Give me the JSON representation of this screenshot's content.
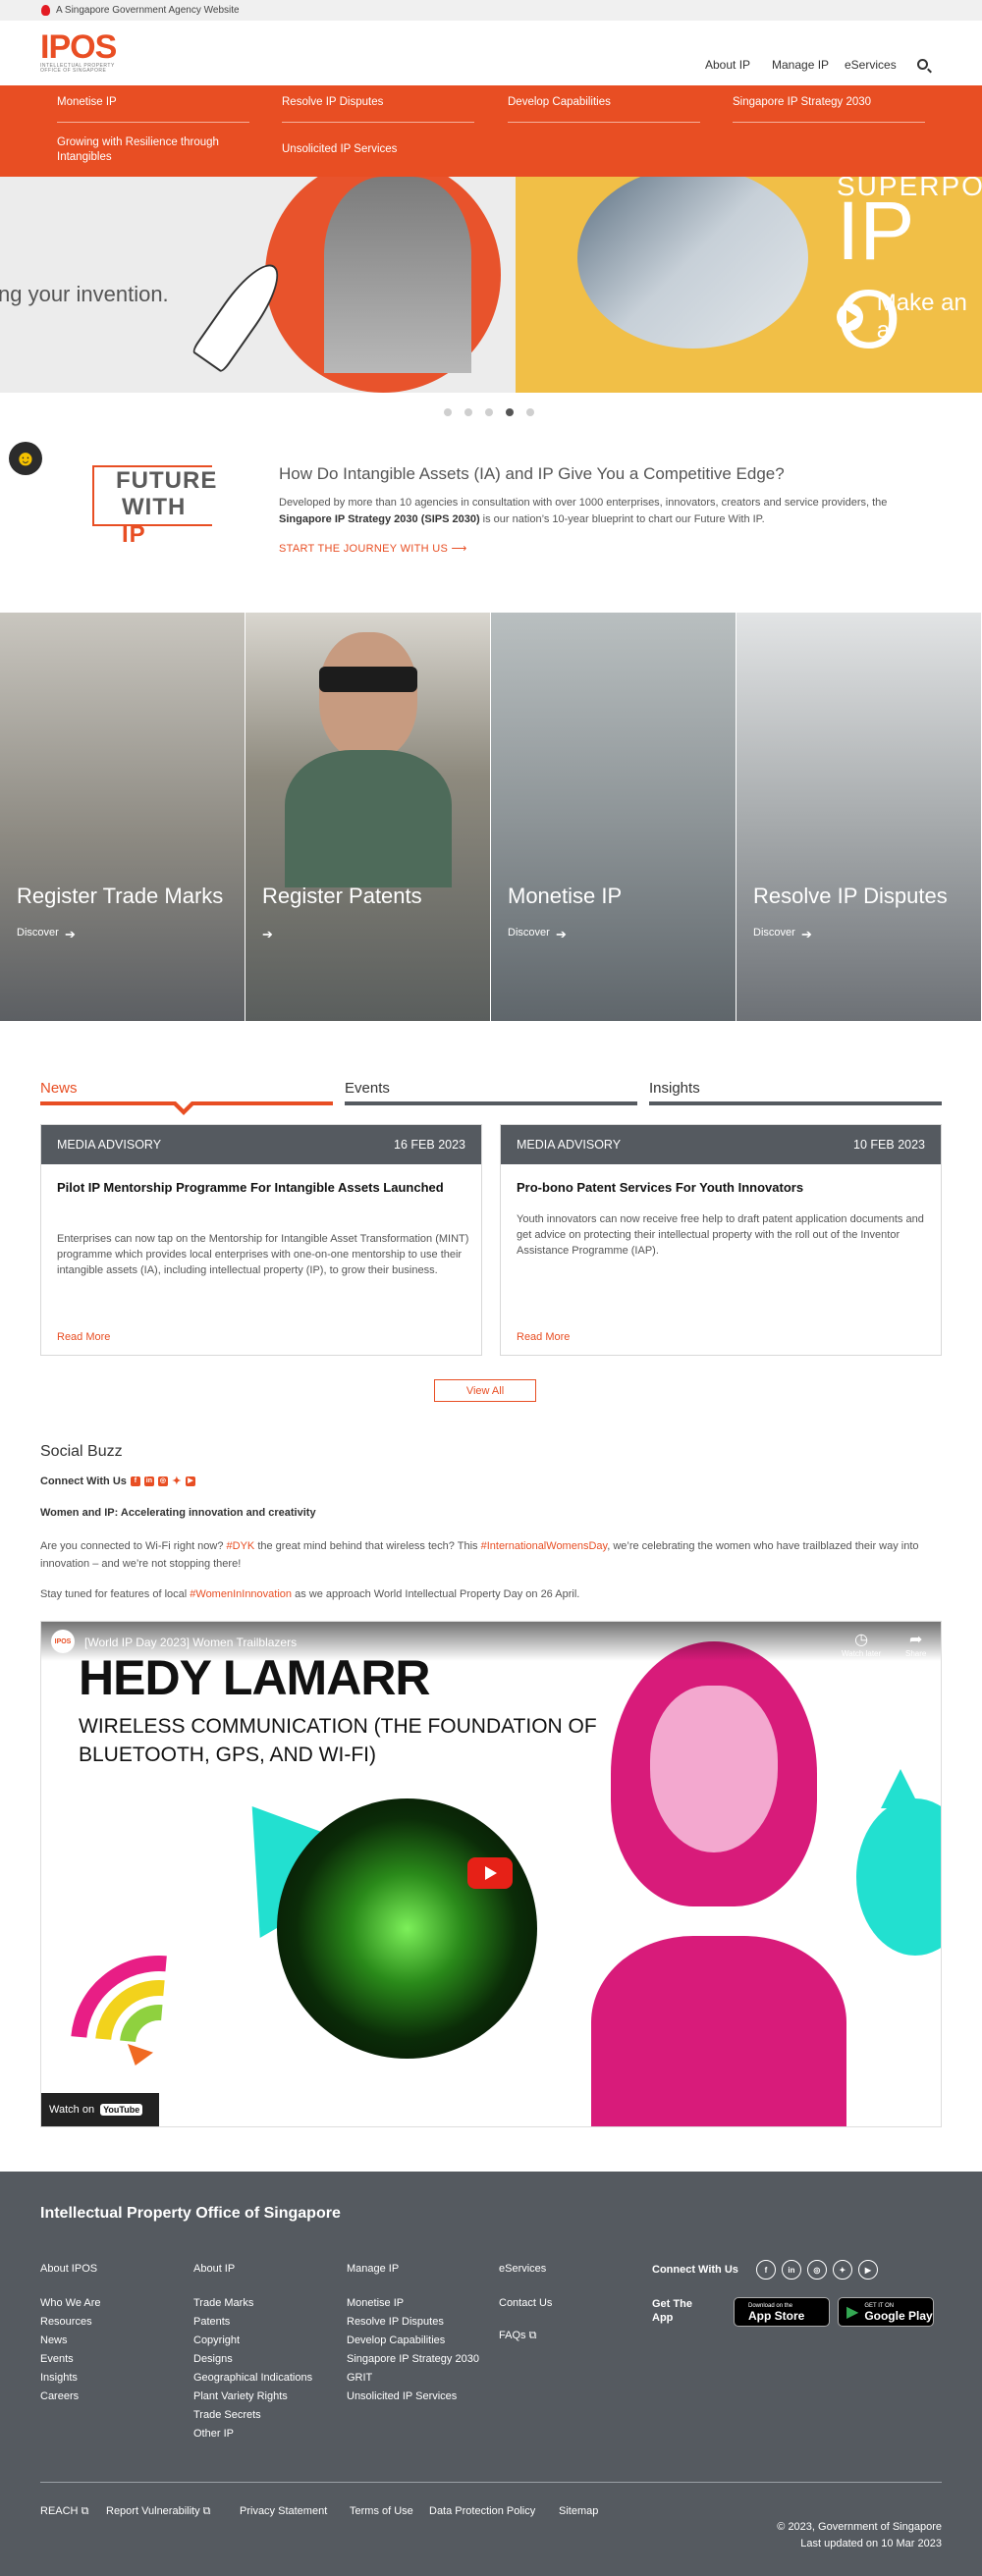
{
  "topbar": {
    "text": "A Singapore Government Agency Website"
  },
  "logo": {
    "name": "IPOS",
    "sub": "INTELLECTUAL PROPERTY OFFICE OF SINGAPORE"
  },
  "nav": [
    "About IP",
    "Manage IP",
    "eServices"
  ],
  "orange_menu": [
    "Monetise IP",
    "Resolve IP Disputes",
    "Develop Capabilities",
    "Singapore IP Strategy 2030",
    "Growing with Resilience through Intangibles",
    "Unsolicited IP Services"
  ],
  "hero": {
    "left_text": "ng your invention.",
    "right_super": "SUPERPOWER",
    "right_big": "IP O",
    "right_cta": "Make an a"
  },
  "carousel": {
    "count": 5,
    "active": 4
  },
  "intro": {
    "logo_line1": "FUTURE",
    "logo_line2a": "WITH ",
    "logo_line2b": "IP",
    "title": "How Do Intangible Assets (IA) and IP Give You a Competitive Edge?",
    "body_1": "Developed by more than 10 agencies in consultation with over 1000 enterprises, innovators, creators and service providers, the ",
    "body_bold": "Singapore IP Strategy 2030 (SIPS 2030)",
    "body_2": " is our nation’s 10-year blueprint to chart our Future With IP.",
    "link": "START THE JOURNEY WITH US"
  },
  "tiles": [
    {
      "title": "Register Trade Marks",
      "discover": "Discover"
    },
    {
      "title": "Register Patents",
      "discover": ""
    },
    {
      "title": "Monetise IP",
      "discover": "Discover"
    },
    {
      "title": "Resolve IP Disputes",
      "discover": "Discover"
    }
  ],
  "tabs": [
    "News",
    "Events",
    "Insights"
  ],
  "cards": [
    {
      "type": "MEDIA ADVISORY",
      "date": "16 FEB 2023",
      "title": "Pilot IP Mentorship Programme For Intangible Assets Launched",
      "body": "Enterprises can now tap on the Mentorship for Intangible Asset Transformation (MINT) programme which provides local enterprises with one-on-one mentorship to use their intangible assets (IA), including intellectual property (IP), to grow their business.",
      "more": "Read More"
    },
    {
      "type": "MEDIA ADVISORY",
      "date": "10 FEB 2023",
      "title": "Pro-bono Patent Services For Youth Innovators",
      "body": "Youth innovators can now receive free help to draft patent application documents and get advice on protecting their intellectual property with the roll out of the Inventor Assistance Programme (IAP).",
      "more": "Read More"
    }
  ],
  "view_all": "View All",
  "social": {
    "title": "Social Buzz",
    "connect": "Connect With Us",
    "headline": "Women and IP: Accelerating innovation and creativity",
    "p1a": "Are you connected to Wi-Fi right now? ",
    "p1b": "#DYK",
    "p1c": " the great mind behind that wireless tech? This ",
    "p1d": "#InternationalWomensDay",
    "p1e": ", we’re celebrating the women who have trailblazed their way into innovation – and we’re not stopping there!",
    "p2a": "Stay tuned for features of local ",
    "p2b": "#WomenInInnovation",
    "p2c": " as we approach World Intellectual Property Day on 26 April."
  },
  "video": {
    "title": "[World IP Day 2023] Women Trailblazers",
    "watch_later": "Watch later",
    "share": "Share",
    "name": "HEDY LAMARR",
    "subtitle": "WIRELESS COMMUNICATION (THE FOUNDATION OF BLUETOOTH, GPS, AND WI-FI)",
    "watch_on": "Watch on",
    "youtube": "YouTube"
  },
  "footer": {
    "title": "Intellectual Property Office of Singapore",
    "cols": [
      {
        "head": "About IPOS",
        "items": [
          "Who We Are",
          "Resources",
          "News",
          "Events",
          "Insights",
          "Careers"
        ]
      },
      {
        "head": "About IP",
        "items": [
          "Trade Marks",
          "Patents",
          "Copyright",
          "Designs",
          "Geographical Indications",
          "Plant Variety Rights",
          "Trade Secrets",
          "Other IP"
        ]
      },
      {
        "head": "Manage IP",
        "items": [
          "Monetise IP",
          "Resolve IP Disputes",
          "Develop Capabilities",
          "Singapore IP Strategy 2030",
          "GRIT",
          "Unsolicited IP Services"
        ]
      },
      {
        "head": "eServices",
        "items": [
          "Contact Us",
          "FAQs"
        ]
      }
    ],
    "connect": "Connect With Us",
    "get_app": "Get The App",
    "appstore_small": "Download on the",
    "appstore": "App Store",
    "gplay_small": "GET IT ON",
    "gplay": "Google Play",
    "bottom_links": [
      "REACH",
      "Report Vulnerability",
      "Privacy Statement",
      "Terms of Use",
      "Data Protection Policy",
      "Sitemap"
    ],
    "copyright": "© 2023, Government of Singapore",
    "updated": "Last updated on 10 Mar 2023"
  },
  "colors": {
    "accent": "#e84e23",
    "footer": "#555a60",
    "hero_yellow": "#f1bf47"
  }
}
